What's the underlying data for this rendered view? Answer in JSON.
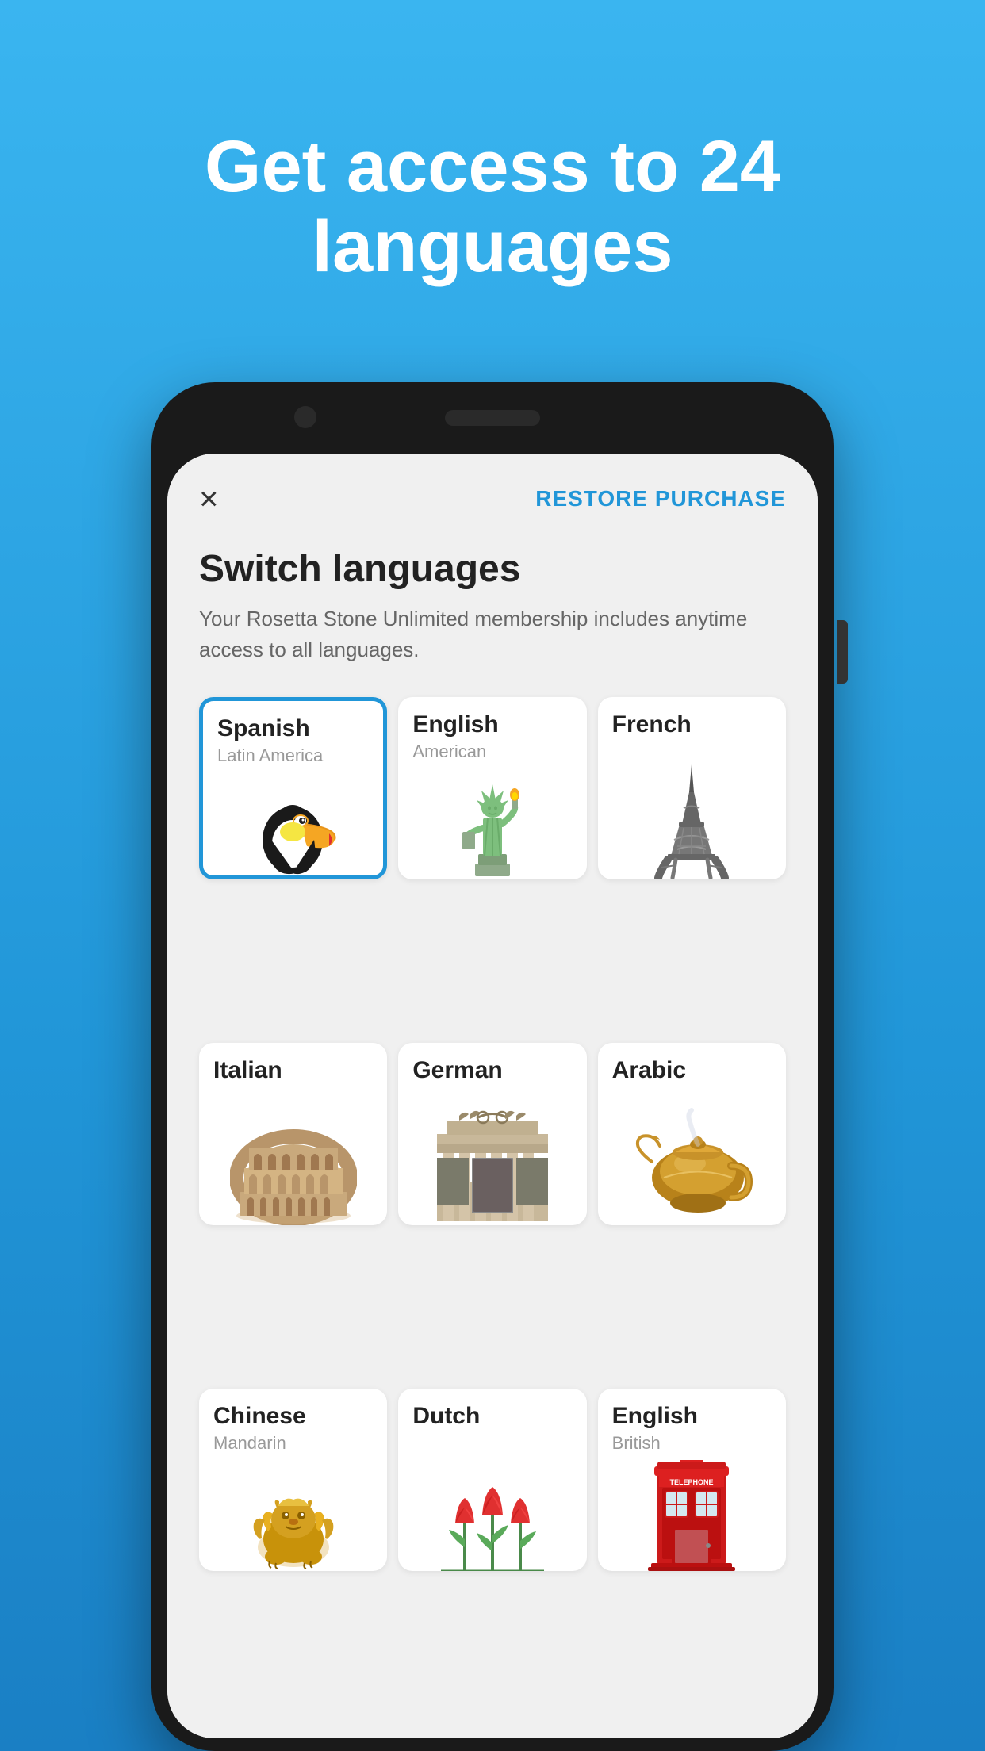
{
  "header": {
    "title": "Get access to 24 languages"
  },
  "screen": {
    "close_label": "×",
    "restore_label": "RESTORE PURCHASE",
    "section_title": "Switch languages",
    "section_desc": "Your Rosetta Stone Unlimited membership includes anytime access to all languages.",
    "languages": [
      {
        "id": "spanish",
        "name": "Spanish",
        "subtitle": "Latin America",
        "selected": true,
        "color": "#2196d8"
      },
      {
        "id": "english-american",
        "name": "English",
        "subtitle": "American",
        "selected": false,
        "color": null
      },
      {
        "id": "french",
        "name": "French",
        "subtitle": "",
        "selected": false,
        "color": null
      },
      {
        "id": "italian",
        "name": "Italian",
        "subtitle": "",
        "selected": false,
        "color": null
      },
      {
        "id": "german",
        "name": "German",
        "subtitle": "",
        "selected": false,
        "color": null
      },
      {
        "id": "arabic",
        "name": "Arabic",
        "subtitle": "",
        "selected": false,
        "color": null
      },
      {
        "id": "chinese",
        "name": "Chinese",
        "subtitle": "Mandarin",
        "selected": false,
        "color": null
      },
      {
        "id": "dutch",
        "name": "Dutch",
        "subtitle": "",
        "selected": false,
        "color": null
      },
      {
        "id": "english-british",
        "name": "English",
        "subtitle": "British",
        "selected": false,
        "color": null
      }
    ]
  }
}
